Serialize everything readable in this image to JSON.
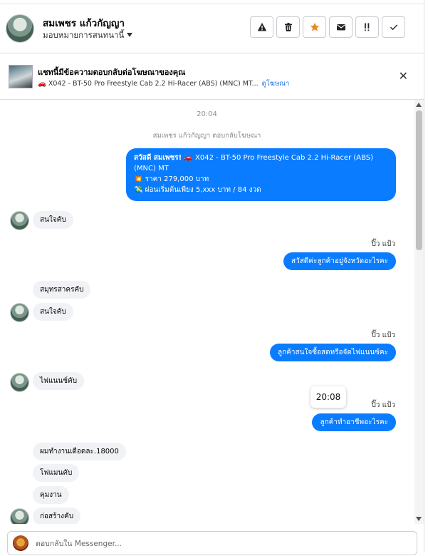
{
  "header": {
    "name": "สมเพชร แก้วกัญญา",
    "assign_label": "มอบหมายการสนทนานี้",
    "actions": [
      {
        "name": "spam-button",
        "icon": "warning-icon"
      },
      {
        "name": "delete-button",
        "icon": "trash-icon"
      },
      {
        "name": "star-button",
        "icon": "star-icon",
        "color": "#e8892b"
      },
      {
        "name": "mark-unread-button",
        "icon": "envelope-icon"
      },
      {
        "name": "follow-up-button",
        "icon": "flag-icon"
      },
      {
        "name": "done-button",
        "icon": "check-icon"
      }
    ]
  },
  "ad_banner": {
    "title": "แชทนี้มีข้อความตอบกลับต่อโฆษณาของคุณ",
    "ad_text": "🚗 X042 - BT-50 Pro Freestyle Cab 2.2 Hi-Racer (ABS) (MNC) MT...",
    "link": "ดูโฆษณา"
  },
  "chat": {
    "timestamp_1": "20:04",
    "system_note": "สมเพชร แก้วกัญญา ตอบกลับโฆษณา",
    "ad_reply_lines": [
      "สวัสดี สมเพชร! 🚗 X042 - BT-50 Pro Freestyle Cab 2.2 Hi-Racer (ABS) (MNC) MT",
      "💥 ราคา 279,000 บาท",
      "💸 ผ่อนเริ่มต้นเพียง 5,xxx บาท / 84 งวด"
    ],
    "ad_reply_greeting": "สวัสดี สมเพชร!",
    "messages": [
      {
        "text": "สนใจคับ"
      },
      {
        "sender": "ปิ๊ว แป้ว",
        "text": "สวัสดีค่ะลูกค้าอยู่จังหวัดอะไรคะ"
      },
      {
        "text": "สมุทรสาครคับ"
      },
      {
        "text": "สนใจคับ"
      },
      {
        "sender": "ปิ๊ว แป้ว",
        "text": "ลูกค้าสนใจซื้อสดหรือจัดไฟแนนซ์คะ"
      },
      {
        "text": "ไฟแนนช์คับ"
      },
      {
        "sender": "ปิ๊ว แป้ว",
        "text": "ลูกค้าทำอาชีพอะไรคะ"
      },
      {
        "text": "ผมทำงานเดือดละ.18000"
      },
      {
        "text": "โฟแมนคับ"
      },
      {
        "text": "คุมงาน"
      },
      {
        "text": "ก่อสร้างคับ"
      }
    ],
    "hover_time": "20:08",
    "accent_color": "#0a7cff"
  },
  "composer": {
    "placeholder": "ตอบกลับใน Messenger..."
  }
}
